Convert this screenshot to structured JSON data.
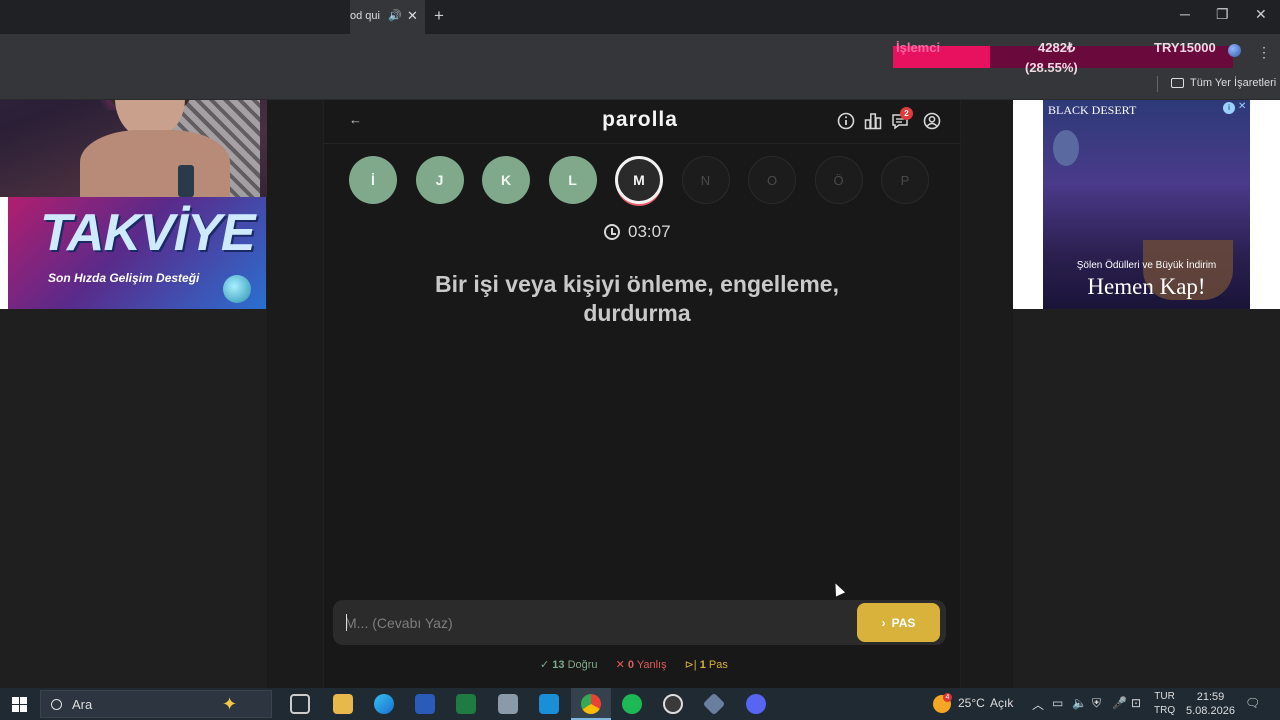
{
  "browser": {
    "tab_title": "od qui",
    "tab_close": "✕",
    "new_tab": "+",
    "bookmark_folder": "Tüm Yer İşaretleri"
  },
  "overlay": {
    "label": "İşlemci",
    "value": "4282₺",
    "percent": "(28.55%)",
    "goal": "TRY15000",
    "progress": 0.2855,
    "fill_color": "#e8115f"
  },
  "game": {
    "logo": "parolla",
    "notifications_count": "2",
    "letters": [
      {
        "char": "İ",
        "state": "done"
      },
      {
        "char": "J",
        "state": "done"
      },
      {
        "char": "K",
        "state": "done"
      },
      {
        "char": "L",
        "state": "done"
      },
      {
        "char": "M",
        "state": "current"
      },
      {
        "char": "N",
        "state": "pending"
      },
      {
        "char": "O",
        "state": "pending"
      },
      {
        "char": "Ö",
        "state": "pending"
      },
      {
        "char": "P",
        "state": "pending"
      }
    ],
    "timer": "03:07",
    "question": "Bir işi veya kişiyi önleme, engelleme, durdurma",
    "answer_placeholder": "M... (Cevabı Yaz)",
    "pass_label": "PAS",
    "stats": {
      "correct_count": "13",
      "correct_label": "Doğru",
      "wrong_count": "0",
      "wrong_label": "Yanlış",
      "pass_count": "1",
      "pass_label": "Pas"
    },
    "colors": {
      "done": "#7fa98a",
      "wrong": "#e25b5b",
      "pass": "#d8b23a"
    }
  },
  "ads": {
    "left_title": "TAKVİYE",
    "left_subtitle": "Son Hızda Gelişim Desteği",
    "right_brand": "BLACK DESERT",
    "right_line1": "Şölen Ödülleri ve Büyük İndirim",
    "right_line2": "Hemen Kap!"
  },
  "taskbar": {
    "search_placeholder": "Ara",
    "weather": "25°C",
    "weather_desc": "Açık",
    "weather_badge": "4",
    "lang_top": "TUR",
    "lang_bottom": "TRQ",
    "time": "21:59",
    "date": "5.08.2026"
  }
}
